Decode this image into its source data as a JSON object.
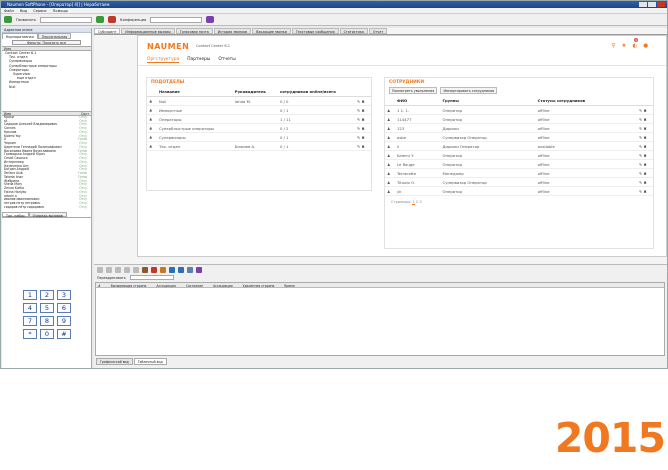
{
  "window": {
    "title": "Naumen SoftPhone - [Оператор] 4[] | Неработаем"
  },
  "menu": [
    "Файл",
    "Вид",
    "Сервис",
    "Помощь"
  ],
  "toolbar": {
    "call_label": "Позвонить",
    "conference_label": "Конференция"
  },
  "left_panel": {
    "title": "Адресная книга",
    "tabs": [
      "Корпоративная",
      "Персональная"
    ],
    "filter_button": "Фильтр: Показать все",
    "tree_header": "Имя",
    "tree": [
      "Contact Center 6.1",
      "Тех. отдел",
      "Супервизоры",
      "Суперблыстрые операторы",
      "Операторы",
      "Supervisor",
      "еще отдел",
      "Импортные",
      "Null"
    ],
    "contacts_header": [
      "Имя",
      "Сост"
    ],
    "contacts": [
      {
        "name": "Кроки",
        "state": "Отсу"
      },
      {
        "name": "sli",
        "state": "Отсу"
      },
      {
        "name": "Сидоров Алексей Владимирович",
        "state": "Отсу"
      },
      {
        "name": "Cannes",
        "state": "Отсу"
      },
      {
        "name": "Крылов",
        "state": "Отсу"
      },
      {
        "name": "Kalemi Yoy",
        "state": "Отсу"
      },
      {
        "name": "X",
        "state": "Готов"
      },
      {
        "name": "Черкин",
        "state": "Отсу"
      },
      {
        "name": "Церетели Геннадий Полиграфович",
        "state": "Отсу"
      },
      {
        "name": "Васильева Ивана Вячеславовна",
        "state": "Готов"
      },
      {
        "name": "Громадько Андрей Юрич",
        "state": "Отсу"
      },
      {
        "name": "Cesidi Casauca",
        "state": "Отсу"
      },
      {
        "name": "Интерплеер",
        "state": "Отсу"
      },
      {
        "name": "Наумченко Ант.",
        "state": "Отсу"
      },
      {
        "name": "Богдан Андрей",
        "state": "Отсу"
      },
      {
        "name": "Terface Asib",
        "state": "Готов"
      },
      {
        "name": "Takeda Iinan",
        "state": "Готов"
      },
      {
        "name": "Жабрини",
        "state": "Отсу"
      },
      {
        "name": "Sheila Mary",
        "state": "Отсу"
      },
      {
        "name": "Zeluro Kwiko",
        "state": "Отсу"
      },
      {
        "name": "Fotina Hariyko",
        "state": "Отсу"
      },
      {
        "name": "arbain a",
        "state": "Отсу"
      },
      {
        "name": "иванов иванпавлович",
        "state": "Отсу"
      },
      {
        "name": "петров петр петрович",
        "state": "Отсу"
      },
      {
        "name": "сидоров пётр сидорович",
        "state": "Отсу"
      }
    ],
    "dial_tabs": [
      "Тон. набор",
      "Очередь вызовов"
    ],
    "keypad": [
      "1",
      "2",
      "3",
      "4",
      "5",
      "6",
      "7",
      "8",
      "9",
      "*",
      "0",
      "#"
    ]
  },
  "tabs": [
    "Субскрипт",
    "Информационные вызовы",
    "Голосовая почта",
    "История звонков",
    "Входящие звонки",
    "Текстовые сообщения",
    "Статистика",
    "Отчет"
  ],
  "web": {
    "brand": "NAUMEN",
    "product": "Contact Center 6.1",
    "notification_count": "4",
    "nav": [
      "Оргструктура",
      "Партнеры",
      "Отчеты"
    ],
    "departments": {
      "title": "ПОДОТДЕЛЫ",
      "columns": [
        "Название",
        "Руководитель",
        "сотрудников online/всего"
      ],
      "rows": [
        {
          "name": "Null",
          "head": "Iahda M.",
          "count": "0 / 0"
        },
        {
          "name": "Импортные",
          "head": "",
          "count": "0 / 1"
        },
        {
          "name": "Операторы",
          "head": "",
          "count": "1 / 11"
        },
        {
          "name": "Суперблыстрые операторы",
          "head": "",
          "count": "0 / 2"
        },
        {
          "name": "Супервизоры",
          "head": "",
          "count": "0 / 1"
        },
        {
          "name": "Тех. отдел",
          "head": "Бижиев А.",
          "count": "0 / 1"
        }
      ]
    },
    "employees": {
      "title": "СОТРУДНИКИ",
      "buttons": [
        "Посмотреть увольнения",
        "Импортировать сотрудников"
      ],
      "columns": [
        "ФИО",
        "Группы",
        "Статусы сотрудников"
      ],
      "rows": [
        {
          "name": "1 1. 1.",
          "group": "Оператор",
          "status": "offline"
        },
        {
          "name": "114477",
          "group": "Оператор",
          "status": "offline"
        },
        {
          "name": "123",
          "group": "Дирижи",
          "status": "offline"
        },
        {
          "name": "asbe",
          "group": "Супервизор Оператор",
          "status": "offline"
        },
        {
          "name": "li",
          "group": "Дирижи Оператор",
          "status": "available"
        },
        {
          "name": "Kalemi Y.",
          "group": "Оператор",
          "status": "offline"
        },
        {
          "name": "Le Rouge",
          "group": "Оператор",
          "status": "offline"
        },
        {
          "name": "Terracotte",
          "group": "Менеджер",
          "status": "offline"
        },
        {
          "name": "Tituoio O.",
          "group": "Супервизор Оператор",
          "status": "offline"
        },
        {
          "name": "yk",
          "group": "Оператор",
          "status": "offline"
        }
      ],
      "pager_label": "Страницы:",
      "pages": [
        "1",
        "2",
        "3"
      ]
    }
  },
  "lower": {
    "redirect_label": "Переадресовать",
    "columns": [
      "#",
      "Вызывающая сторона",
      "Ассоциация",
      "Состояние",
      "Ассоциации",
      "Удаленная сторона",
      "Время"
    ],
    "bottom_tabs": [
      "Графический вид",
      "Табличный вид"
    ]
  },
  "year": "2015"
}
